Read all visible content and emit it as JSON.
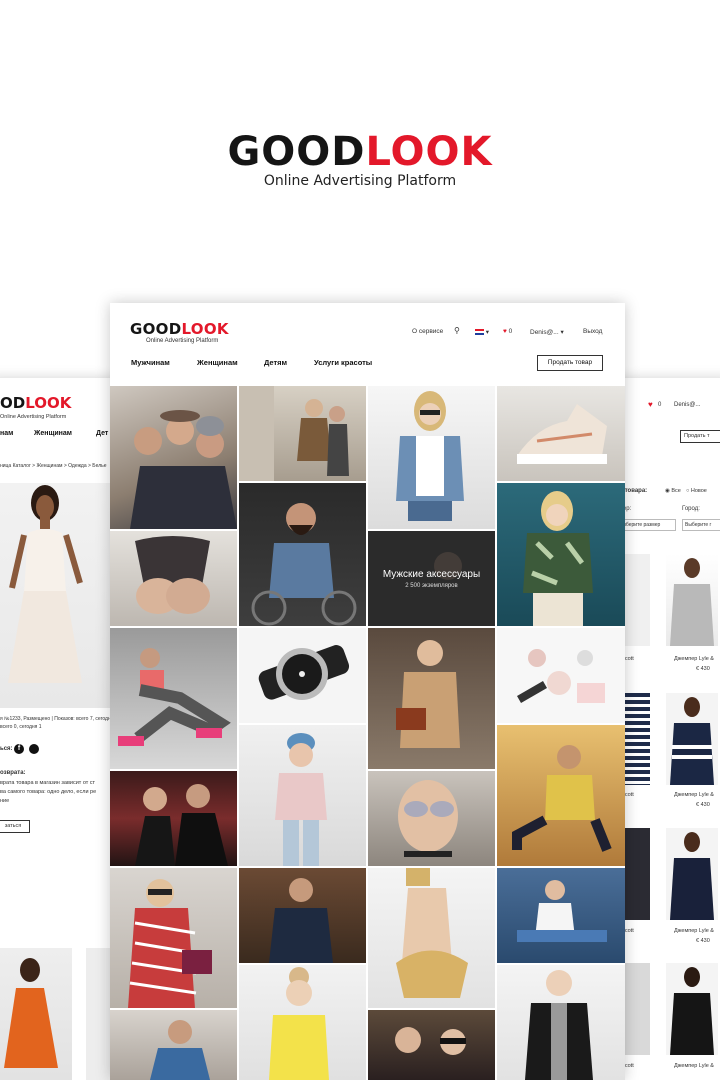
{
  "hero": {
    "logo_part1": "GOOD",
    "logo_part2": "LOOK",
    "tagline": "Online Advertising Platform"
  },
  "brand_colors": {
    "black": "#151515",
    "red": "#e3182a"
  },
  "main_header": {
    "logo_part1": "GOOD",
    "logo_part2": "LOOK",
    "logo_sub": "Online Advertising Platform",
    "about": "О сервисе",
    "favorites_count": "0",
    "user": "Denis@...",
    "logout": "Выход",
    "nav": [
      "Мужчинам",
      "Женщинам",
      "Детям",
      "Услуги красоты"
    ],
    "sell_button": "Продать товар"
  },
  "category_tile": {
    "title": "Мужские аксессуары",
    "count": "2 500 экземпляров"
  },
  "left_mock": {
    "logo_part2": "LOOK",
    "logo_sub": "Online Advertising Platform",
    "nav": [
      "нам",
      "Женщинам",
      "Дет"
    ],
    "breadcrumb": "ница Каталог > Женщинам > Одежда > Белье",
    "meta_line1": "я №1233, Размещено | Показов: всего 7, сегодня",
    "meta_line2": "всего 0, сегодня 1",
    "share_label": "ься:",
    "return_title": "озврата:",
    "return_text1": "врата товара в магазин зависит от ст",
    "return_text2": "ва самого товара: одно дело, если ре",
    "return_text3": "ние",
    "contact_button": "заться"
  },
  "right_mock": {
    "favorites_count": "0",
    "user": "Denis@...",
    "sell_button": "Продать т",
    "filter_label": "ие товара:",
    "filter_all": "Все",
    "filter_new": "Новое",
    "size_label": "змер:",
    "size_select": "Выберите размер",
    "city_label": "Город:",
    "city_select": "Выберите г",
    "products": [
      {
        "name_left": "& Scott",
        "name": "Джемпер Lyle &",
        "price": "€ 430"
      },
      {
        "name_left": "& Scott",
        "name": "Джемпер Lyle &",
        "price": "€ 430"
      },
      {
        "name_left": "& Scott",
        "name": "Джемпер Lyle &",
        "price": "€ 430"
      },
      {
        "name_left": "& Scott",
        "name": "Джемпер Lyle &",
        "price": "€ 430"
      }
    ]
  }
}
